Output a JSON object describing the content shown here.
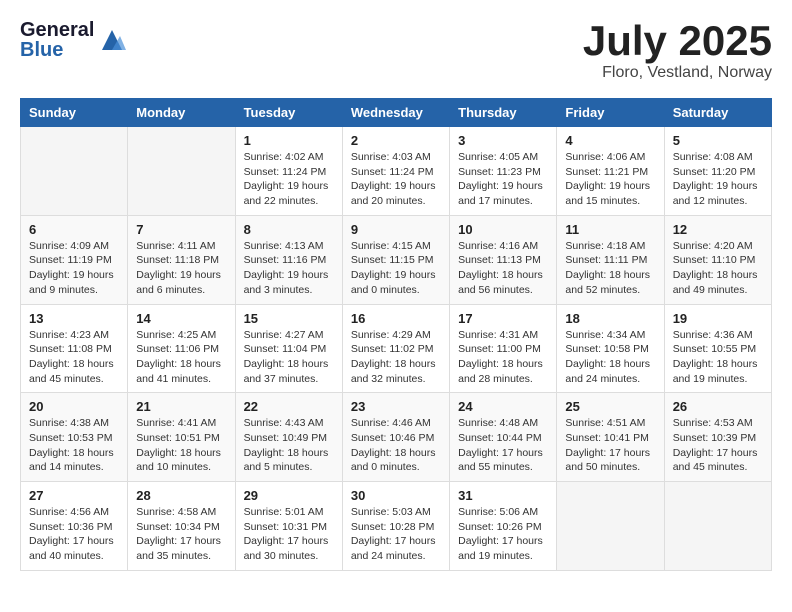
{
  "header": {
    "logo_general": "General",
    "logo_blue": "Blue",
    "month": "July 2025",
    "location": "Floro, Vestland, Norway"
  },
  "weekdays": [
    "Sunday",
    "Monday",
    "Tuesday",
    "Wednesday",
    "Thursday",
    "Friday",
    "Saturday"
  ],
  "weeks": [
    [
      null,
      null,
      {
        "day": 1,
        "sunrise": "4:02 AM",
        "sunset": "11:24 PM",
        "daylight": "19 hours and 22 minutes."
      },
      {
        "day": 2,
        "sunrise": "4:03 AM",
        "sunset": "11:24 PM",
        "daylight": "19 hours and 20 minutes."
      },
      {
        "day": 3,
        "sunrise": "4:05 AM",
        "sunset": "11:23 PM",
        "daylight": "19 hours and 17 minutes."
      },
      {
        "day": 4,
        "sunrise": "4:06 AM",
        "sunset": "11:21 PM",
        "daylight": "19 hours and 15 minutes."
      },
      {
        "day": 5,
        "sunrise": "4:08 AM",
        "sunset": "11:20 PM",
        "daylight": "19 hours and 12 minutes."
      }
    ],
    [
      {
        "day": 6,
        "sunrise": "4:09 AM",
        "sunset": "11:19 PM",
        "daylight": "19 hours and 9 minutes."
      },
      {
        "day": 7,
        "sunrise": "4:11 AM",
        "sunset": "11:18 PM",
        "daylight": "19 hours and 6 minutes."
      },
      {
        "day": 8,
        "sunrise": "4:13 AM",
        "sunset": "11:16 PM",
        "daylight": "19 hours and 3 minutes."
      },
      {
        "day": 9,
        "sunrise": "4:15 AM",
        "sunset": "11:15 PM",
        "daylight": "19 hours and 0 minutes."
      },
      {
        "day": 10,
        "sunrise": "4:16 AM",
        "sunset": "11:13 PM",
        "daylight": "18 hours and 56 minutes."
      },
      {
        "day": 11,
        "sunrise": "4:18 AM",
        "sunset": "11:11 PM",
        "daylight": "18 hours and 52 minutes."
      },
      {
        "day": 12,
        "sunrise": "4:20 AM",
        "sunset": "11:10 PM",
        "daylight": "18 hours and 49 minutes."
      }
    ],
    [
      {
        "day": 13,
        "sunrise": "4:23 AM",
        "sunset": "11:08 PM",
        "daylight": "18 hours and 45 minutes."
      },
      {
        "day": 14,
        "sunrise": "4:25 AM",
        "sunset": "11:06 PM",
        "daylight": "18 hours and 41 minutes."
      },
      {
        "day": 15,
        "sunrise": "4:27 AM",
        "sunset": "11:04 PM",
        "daylight": "18 hours and 37 minutes."
      },
      {
        "day": 16,
        "sunrise": "4:29 AM",
        "sunset": "11:02 PM",
        "daylight": "18 hours and 32 minutes."
      },
      {
        "day": 17,
        "sunrise": "4:31 AM",
        "sunset": "11:00 PM",
        "daylight": "18 hours and 28 minutes."
      },
      {
        "day": 18,
        "sunrise": "4:34 AM",
        "sunset": "10:58 PM",
        "daylight": "18 hours and 24 minutes."
      },
      {
        "day": 19,
        "sunrise": "4:36 AM",
        "sunset": "10:55 PM",
        "daylight": "18 hours and 19 minutes."
      }
    ],
    [
      {
        "day": 20,
        "sunrise": "4:38 AM",
        "sunset": "10:53 PM",
        "daylight": "18 hours and 14 minutes."
      },
      {
        "day": 21,
        "sunrise": "4:41 AM",
        "sunset": "10:51 PM",
        "daylight": "18 hours and 10 minutes."
      },
      {
        "day": 22,
        "sunrise": "4:43 AM",
        "sunset": "10:49 PM",
        "daylight": "18 hours and 5 minutes."
      },
      {
        "day": 23,
        "sunrise": "4:46 AM",
        "sunset": "10:46 PM",
        "daylight": "18 hours and 0 minutes."
      },
      {
        "day": 24,
        "sunrise": "4:48 AM",
        "sunset": "10:44 PM",
        "daylight": "17 hours and 55 minutes."
      },
      {
        "day": 25,
        "sunrise": "4:51 AM",
        "sunset": "10:41 PM",
        "daylight": "17 hours and 50 minutes."
      },
      {
        "day": 26,
        "sunrise": "4:53 AM",
        "sunset": "10:39 PM",
        "daylight": "17 hours and 45 minutes."
      }
    ],
    [
      {
        "day": 27,
        "sunrise": "4:56 AM",
        "sunset": "10:36 PM",
        "daylight": "17 hours and 40 minutes."
      },
      {
        "day": 28,
        "sunrise": "4:58 AM",
        "sunset": "10:34 PM",
        "daylight": "17 hours and 35 minutes."
      },
      {
        "day": 29,
        "sunrise": "5:01 AM",
        "sunset": "10:31 PM",
        "daylight": "17 hours and 30 minutes."
      },
      {
        "day": 30,
        "sunrise": "5:03 AM",
        "sunset": "10:28 PM",
        "daylight": "17 hours and 24 minutes."
      },
      {
        "day": 31,
        "sunrise": "5:06 AM",
        "sunset": "10:26 PM",
        "daylight": "17 hours and 19 minutes."
      },
      null,
      null
    ]
  ],
  "labels": {
    "sunrise": "Sunrise:",
    "sunset": "Sunset:",
    "daylight": "Daylight:"
  }
}
